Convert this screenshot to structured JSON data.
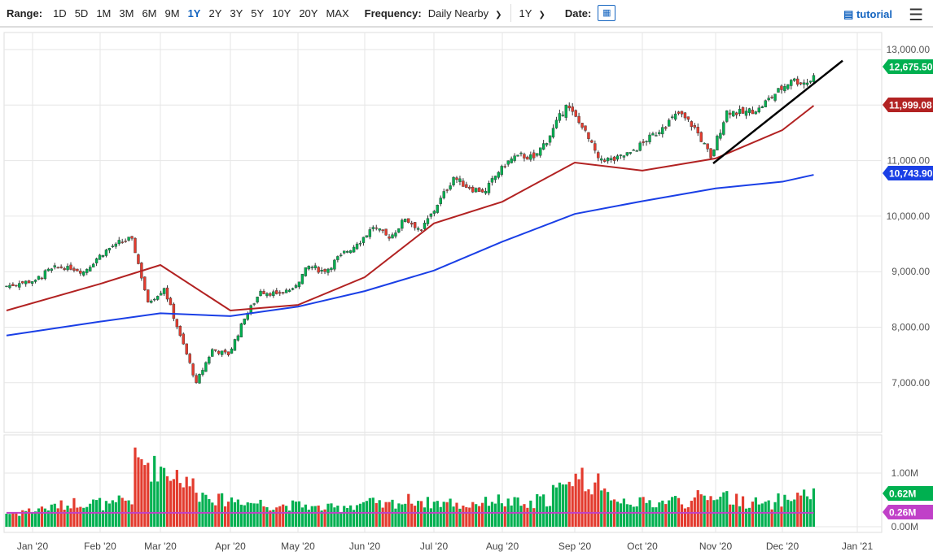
{
  "toolbar": {
    "range_label": "Range:",
    "ranges": [
      "1D",
      "5D",
      "1M",
      "3M",
      "6M",
      "9M",
      "1Y",
      "2Y",
      "3Y",
      "5Y",
      "10Y",
      "20Y",
      "MAX"
    ],
    "active_range": "1Y",
    "frequency_label": "Frequency:",
    "frequency": "Daily Nearby",
    "period": "1Y",
    "date_label": "Date:",
    "tutorial": "tutorial"
  },
  "chart_data": {
    "type": "candlestick",
    "price_axis": {
      "ylim": [
        6200,
        13300
      ],
      "ticks": [
        "13,000.00",
        "12,000.00",
        "11,000.00",
        "10,000.00",
        "9,000.00",
        "8,000.00",
        "7,000.00"
      ],
      "tick_values": [
        13000,
        12000,
        11000,
        10000,
        9000,
        8000,
        7000
      ]
    },
    "x_ticks": [
      "Jan '20",
      "Feb '20",
      "Mar '20",
      "Apr '20",
      "May '20",
      "Jun '20",
      "Jul '20",
      "Aug '20",
      "Sep '20",
      "Oct '20",
      "Nov '20",
      "Dec '20",
      "Jan '21"
    ],
    "weekly_closes": [
      8790,
      8850,
      9050,
      9100,
      9000,
      9300,
      9500,
      9600,
      8450,
      8700,
      7850,
      7000,
      7600,
      7500,
      8150,
      8650,
      8600,
      8700,
      9100,
      9000,
      9300,
      9500,
      9800,
      9600,
      9950,
      9750,
      10200,
      10700,
      10500,
      10450,
      10900,
      11100,
      11050,
      11450,
      12000,
      11600,
      11050,
      11000,
      11150,
      11350,
      11600,
      11850,
      11600,
      11050,
      11900,
      11850,
      11950,
      12200,
      12450,
      12400,
      12675
    ],
    "ma50_monthly": [
      8300,
      8780,
      9120,
      8300,
      8400,
      8900,
      9870,
      10260,
      10965,
      10820,
      11040,
      11550,
      11990
    ],
    "ma200_monthly": [
      7850,
      8100,
      8250,
      8200,
      8370,
      8650,
      9020,
      9540,
      10040,
      10270,
      10500,
      10620,
      10744
    ],
    "trendline": {
      "from": 10950,
      "to": 12800
    },
    "last_price": "12,675.50",
    "ma50_last": "11,999.08",
    "ma200_last": "10,743.90",
    "volume_axis": {
      "ticks": [
        "1.00M",
        "0.00M"
      ],
      "tick_values": [
        1,
        0
      ]
    },
    "weekly_volume": [
      0.25,
      0.3,
      0.35,
      0.4,
      0.45,
      0.45,
      0.4,
      0.5,
      1.2,
      1.1,
      1.0,
      0.8,
      0.6,
      0.5,
      0.5,
      0.45,
      0.4,
      0.4,
      0.4,
      0.35,
      0.35,
      0.4,
      0.45,
      0.4,
      0.45,
      0.5,
      0.45,
      0.45,
      0.4,
      0.45,
      0.5,
      0.45,
      0.4,
      0.5,
      0.7,
      0.95,
      0.8,
      0.6,
      0.5,
      0.45,
      0.45,
      0.5,
      0.45,
      0.55,
      0.6,
      0.5,
      0.45,
      0.4,
      0.5,
      0.6,
      0.62
    ],
    "volume_ma": 0.26,
    "volume_last": "0.62M",
    "volume_ma_last": "0.26M",
    "colors": {
      "up": "#00b050",
      "down": "#e33b2e",
      "ma50": "#b22222",
      "ma200": "#1a3fe6",
      "vol_ma": "#c040c8"
    }
  }
}
